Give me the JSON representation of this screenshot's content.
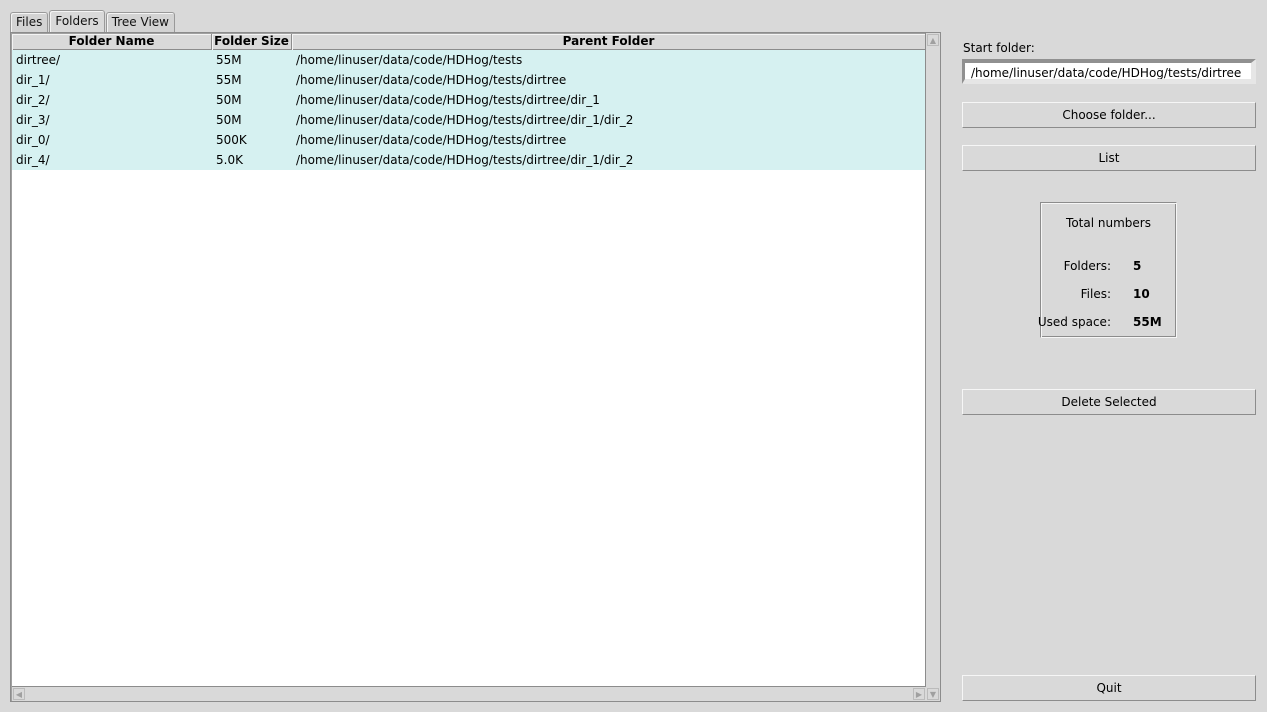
{
  "tabs": [
    {
      "label": "Files",
      "active": false
    },
    {
      "label": "Folders",
      "active": true
    },
    {
      "label": "Tree View",
      "active": false
    }
  ],
  "table": {
    "columns": [
      "Folder Name",
      "Folder Size",
      "Parent Folder"
    ],
    "rows": [
      {
        "name": "dirtree/",
        "size": "55M",
        "parent": "/home/linuser/data/code/HDHog/tests"
      },
      {
        "name": "dir_1/",
        "size": "55M",
        "parent": "/home/linuser/data/code/HDHog/tests/dirtree"
      },
      {
        "name": "dir_2/",
        "size": "50M",
        "parent": "/home/linuser/data/code/HDHog/tests/dirtree/dir_1"
      },
      {
        "name": "dir_3/",
        "size": "50M",
        "parent": "/home/linuser/data/code/HDHog/tests/dirtree/dir_1/dir_2"
      },
      {
        "name": "dir_0/",
        "size": "500K",
        "parent": "/home/linuser/data/code/HDHog/tests/dirtree"
      },
      {
        "name": "dir_4/",
        "size": "5.0K",
        "parent": "/home/linuser/data/code/HDHog/tests/dirtree/dir_1/dir_2"
      }
    ],
    "row_color": "#d6f1f1"
  },
  "scrollbars": {
    "up_icon": "▲",
    "down_icon": "▼",
    "left_icon": "◀",
    "right_icon": "▶"
  },
  "panel": {
    "start_folder_label": "Start folder:",
    "start_folder_value": "/home/linuser/data/code/HDHog/tests/dirtree",
    "choose_folder_label": "Choose folder...",
    "list_label": "List",
    "delete_label": "Delete Selected",
    "quit_label": "Quit",
    "totals": {
      "title": "Total numbers",
      "folders_label": "Folders:",
      "folders_value": "5",
      "files_label": "Files:",
      "files_value": "10",
      "used_label": "Used space:",
      "used_value": "55M"
    }
  }
}
